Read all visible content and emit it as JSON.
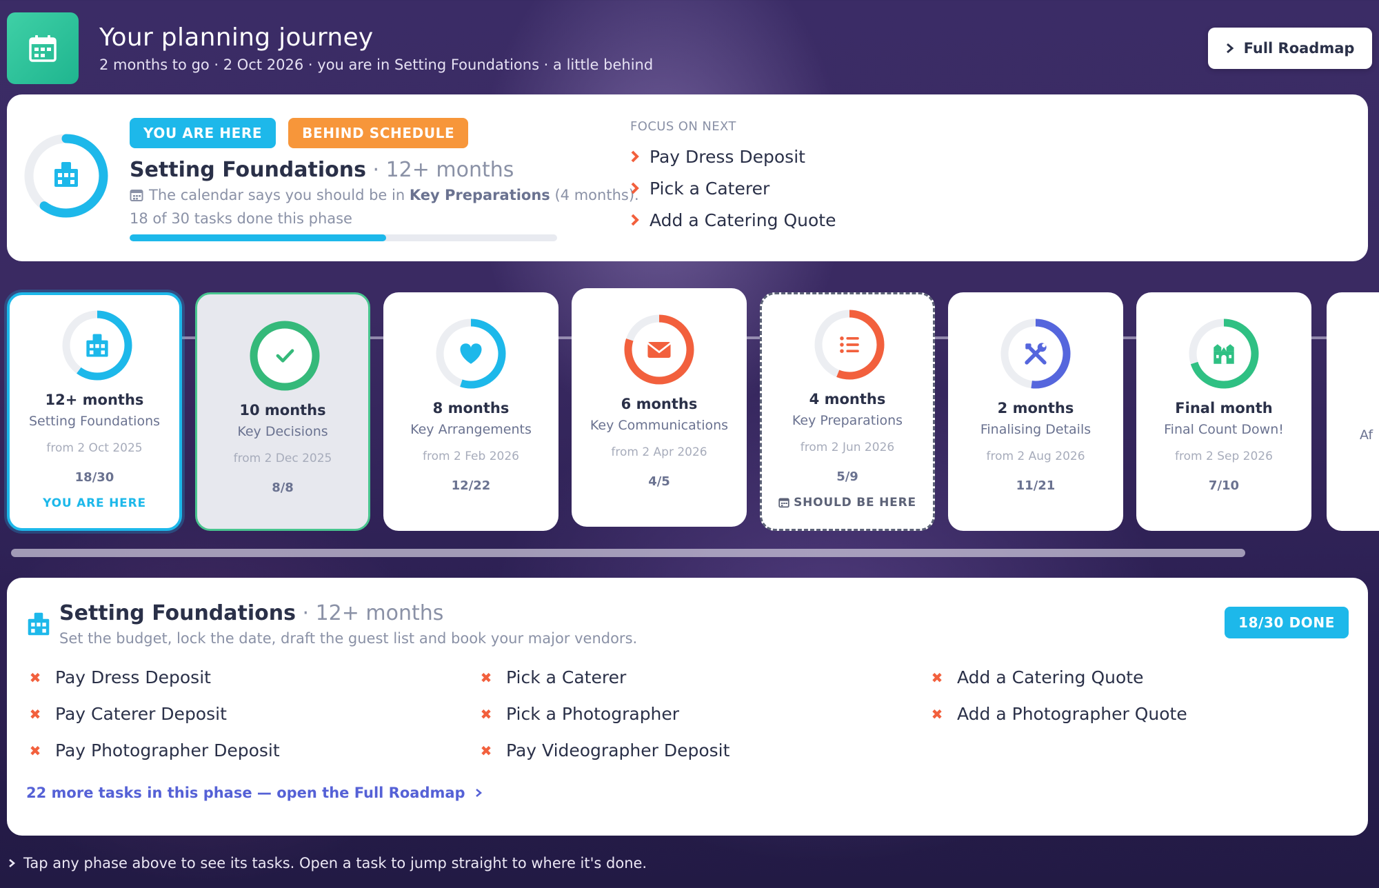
{
  "header": {
    "title": "Your planning journey",
    "subtitle": "2 months to go · 2 Oct 2026 · you are in Setting Foundations · a little behind",
    "roadmap_button": "Full Roadmap",
    "icon": "calendar-icon"
  },
  "current": {
    "badge_here": "YOU ARE HERE",
    "badge_behind": "BEHIND SCHEDULE",
    "name": "Setting Foundations",
    "duration": " · 12+ months",
    "calendar_prefix": "The calendar says you should be in ",
    "calendar_phase": "Key Preparations",
    "calendar_suffix": " (4 months).",
    "tasks_done_text": "18 of 30 tasks done this phase",
    "progress": 0.6,
    "focus_heading": "FOCUS ON NEXT",
    "focus_items": [
      "Pay Dress Deposit",
      "Pick a Caterer",
      "Add a Catering Quote"
    ]
  },
  "phases": [
    {
      "duration": "12+ months",
      "name": "Setting Foundations",
      "from": "from 2 Oct 2025",
      "count": "18/30",
      "tag": "YOU ARE HERE",
      "progress": 0.6,
      "color": "#1db8ea",
      "icon": "building-icon",
      "state": "current"
    },
    {
      "duration": "10 months",
      "name": "Key Decisions",
      "from": "from 2 Dec 2025",
      "count": "8/8",
      "tag": "",
      "progress": 1.0,
      "color": "#35b97a",
      "icon": "check-icon",
      "state": "done"
    },
    {
      "duration": "8 months",
      "name": "Key Arrangements",
      "from": "from 2 Feb 2026",
      "count": "12/22",
      "tag": "",
      "progress": 0.55,
      "color": "#1db8ea",
      "icon": "heart-icon",
      "state": "upcoming"
    },
    {
      "duration": "6 months",
      "name": "Key Communications",
      "from": "from 2 Apr 2026",
      "count": "4/5",
      "tag": "",
      "progress": 0.8,
      "color": "#f2603d",
      "icon": "envelope-icon",
      "state": "upcoming"
    },
    {
      "duration": "4 months",
      "name": "Key Preparations",
      "from": "from 2 Jun 2026",
      "count": "5/9",
      "tag": "SHOULD BE HERE",
      "progress": 0.56,
      "color": "#f2603d",
      "icon": "list-icon",
      "state": "should"
    },
    {
      "duration": "2 months",
      "name": "Finalising Details",
      "from": "from 2 Aug 2026",
      "count": "11/21",
      "tag": "",
      "progress": 0.52,
      "color": "#5566dd",
      "icon": "tools-icon",
      "state": "upcoming"
    },
    {
      "duration": "Final month",
      "name": "Final Count Down!",
      "from": "from 2 Sep 2026",
      "count": "7/10",
      "tag": "",
      "progress": 0.7,
      "color": "#2fc083",
      "icon": "church-icon",
      "state": "upcoming"
    }
  ],
  "partial_phase_text": "Af",
  "detail": {
    "name": "Setting Foundations",
    "duration": " · 12+ months",
    "description": "Set the budget, lock the date, draft the guest list and book your major vendors.",
    "badge": "18/30 DONE",
    "tasks": [
      "Pay Dress Deposit",
      "Pick a Caterer",
      "Add a Catering Quote",
      "Pay Caterer Deposit",
      "Pick a Photographer",
      "Add a Photographer Quote",
      "Pay Photographer Deposit",
      "Pay Videographer Deposit"
    ],
    "more_link": "22 more tasks in this phase — open the Full Roadmap"
  },
  "footer_tip": "Tap any phase above to see its tasks. Open a task to jump straight to where it's done."
}
